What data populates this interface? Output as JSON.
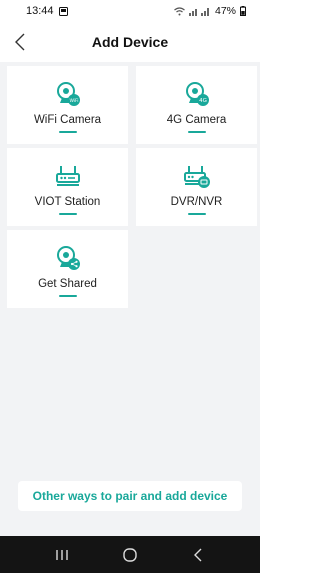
{
  "status_bar": {
    "time": "13:44",
    "battery": "47%",
    "left_icons": [
      "screenshot-icon"
    ],
    "right_icons": [
      "wifi-icon",
      "signal-icon",
      "battery-icon"
    ]
  },
  "header": {
    "title": "Add Device",
    "back_icon": "chevron-left-icon"
  },
  "devices": [
    {
      "label": "WiFi Camera",
      "icon": "wifi-camera-icon"
    },
    {
      "label": "4G Camera",
      "icon": "4g-camera-icon"
    },
    {
      "label": "VIOT Station",
      "icon": "router-icon"
    },
    {
      "label": "DVR/NVR",
      "icon": "dvr-nvr-icon"
    },
    {
      "label": "Get Shared",
      "icon": "shared-camera-icon"
    }
  ],
  "other_ways": {
    "label": "Other ways to pair and add device"
  },
  "colors": {
    "accent": "#19a89a",
    "background": "#f2f3f5",
    "nav_bar": "#141414"
  },
  "nav_bar": {
    "buttons": [
      "recents-icon",
      "home-icon",
      "back-icon"
    ]
  }
}
